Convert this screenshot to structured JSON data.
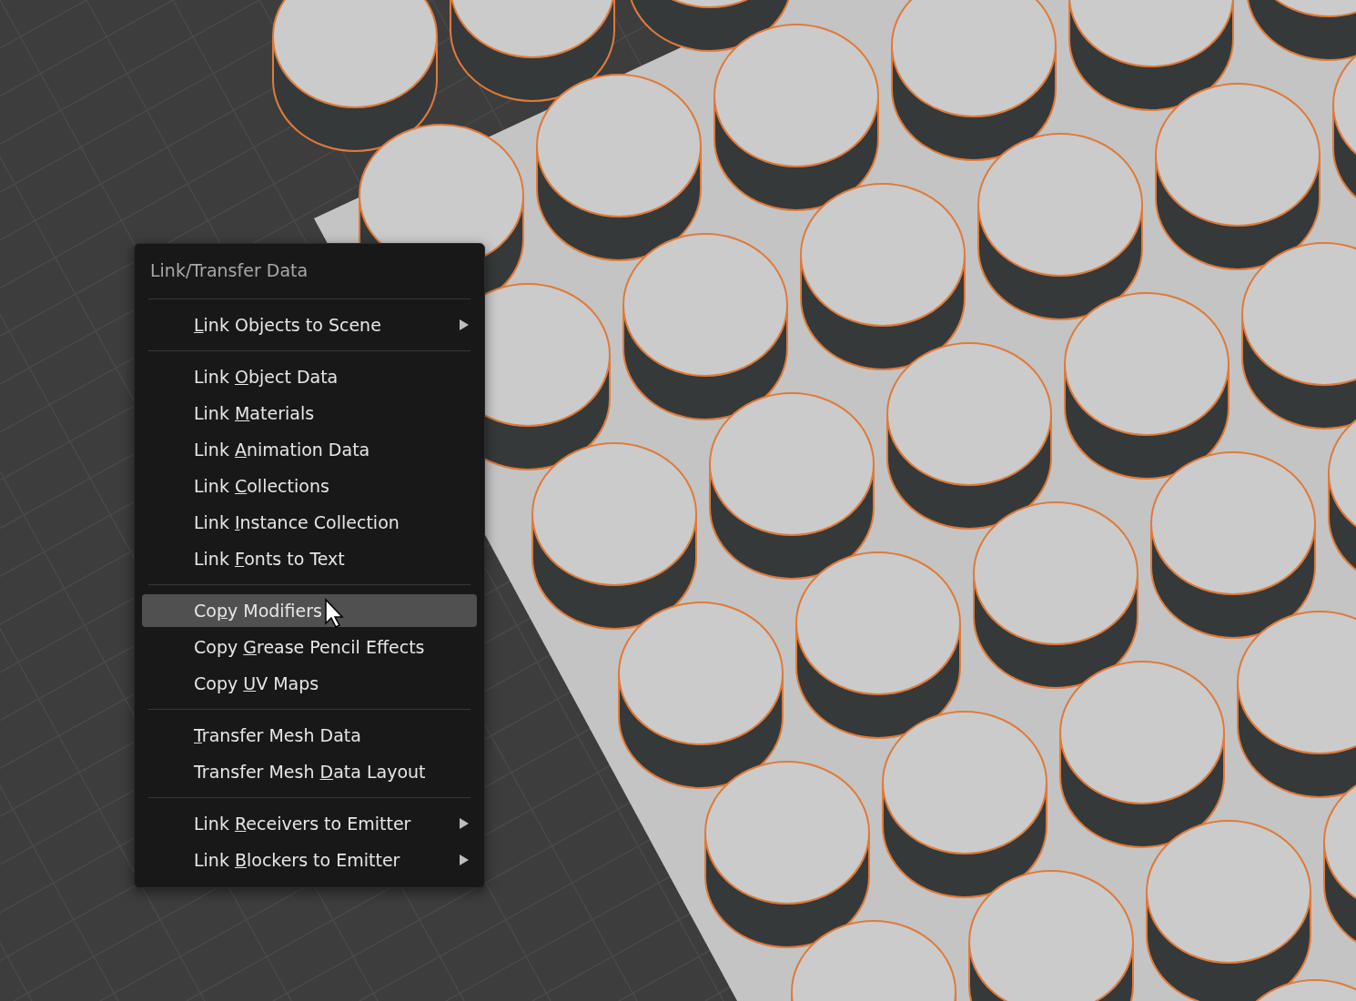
{
  "menu": {
    "title": "Link/Transfer Data",
    "items": [
      {
        "kind": "separator"
      },
      {
        "kind": "item",
        "key": "L",
        "post": "ink Objects to Scene",
        "submenu": true,
        "selected": false
      },
      {
        "kind": "separator"
      },
      {
        "kind": "item",
        "pre": "Link ",
        "key": "O",
        "post": "bject Data",
        "submenu": false,
        "selected": false
      },
      {
        "kind": "item",
        "pre": "Link ",
        "key": "M",
        "post": "aterials",
        "submenu": false,
        "selected": false
      },
      {
        "kind": "item",
        "pre": "Link ",
        "key": "A",
        "post": "nimation Data",
        "submenu": false,
        "selected": false
      },
      {
        "kind": "item",
        "pre": "Link ",
        "key": "C",
        "post": "ollections",
        "submenu": false,
        "selected": false
      },
      {
        "kind": "item",
        "pre": "Link ",
        "key": "I",
        "post": "nstance Collection",
        "submenu": false,
        "selected": false
      },
      {
        "kind": "item",
        "pre": "Link ",
        "key": "F",
        "post": "onts to Text",
        "submenu": false,
        "selected": false
      },
      {
        "kind": "separator"
      },
      {
        "kind": "item",
        "pre": "Co",
        "key": "p",
        "post": "y Modifiers",
        "submenu": false,
        "selected": true
      },
      {
        "kind": "item",
        "pre": "Copy ",
        "key": "G",
        "post": "rease Pencil Effects",
        "submenu": false,
        "selected": false
      },
      {
        "kind": "item",
        "pre": "Copy ",
        "key": "U",
        "post": "V Maps",
        "submenu": false,
        "selected": false
      },
      {
        "kind": "separator"
      },
      {
        "kind": "item",
        "key": "T",
        "post": "ransfer Mesh Data",
        "submenu": false,
        "selected": false
      },
      {
        "kind": "item",
        "pre": "Transfer Mesh ",
        "key": "D",
        "post": "ata Layout",
        "submenu": false,
        "selected": false
      },
      {
        "kind": "separator"
      },
      {
        "kind": "item",
        "pre": "Link ",
        "key": "R",
        "post": "eceivers to Emitter",
        "submenu": true,
        "selected": false
      },
      {
        "kind": "item",
        "pre": "Link ",
        "key": "B",
        "post": "lockers to Emitter",
        "submenu": true,
        "selected": false
      }
    ]
  }
}
